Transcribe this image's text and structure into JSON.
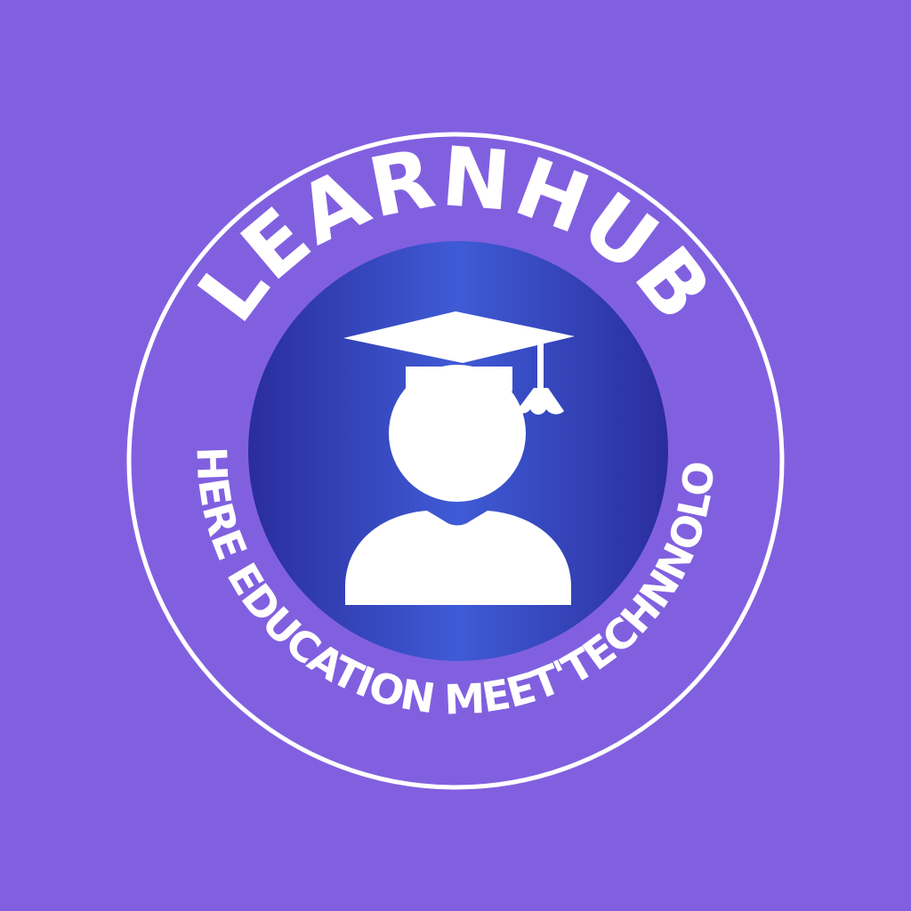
{
  "badge": {
    "brand_name": "LEARNHUB",
    "tagline": "WHERE EDUCATION MEET'TECHNNOLOGY",
    "icon": "graduate-student-icon"
  },
  "colors": {
    "background": "#8160e0",
    "ring": "#ffffff",
    "emblem_dark": "#2f2fa6",
    "emblem_light": "#3f5bd6",
    "icon": "#ffffff"
  }
}
